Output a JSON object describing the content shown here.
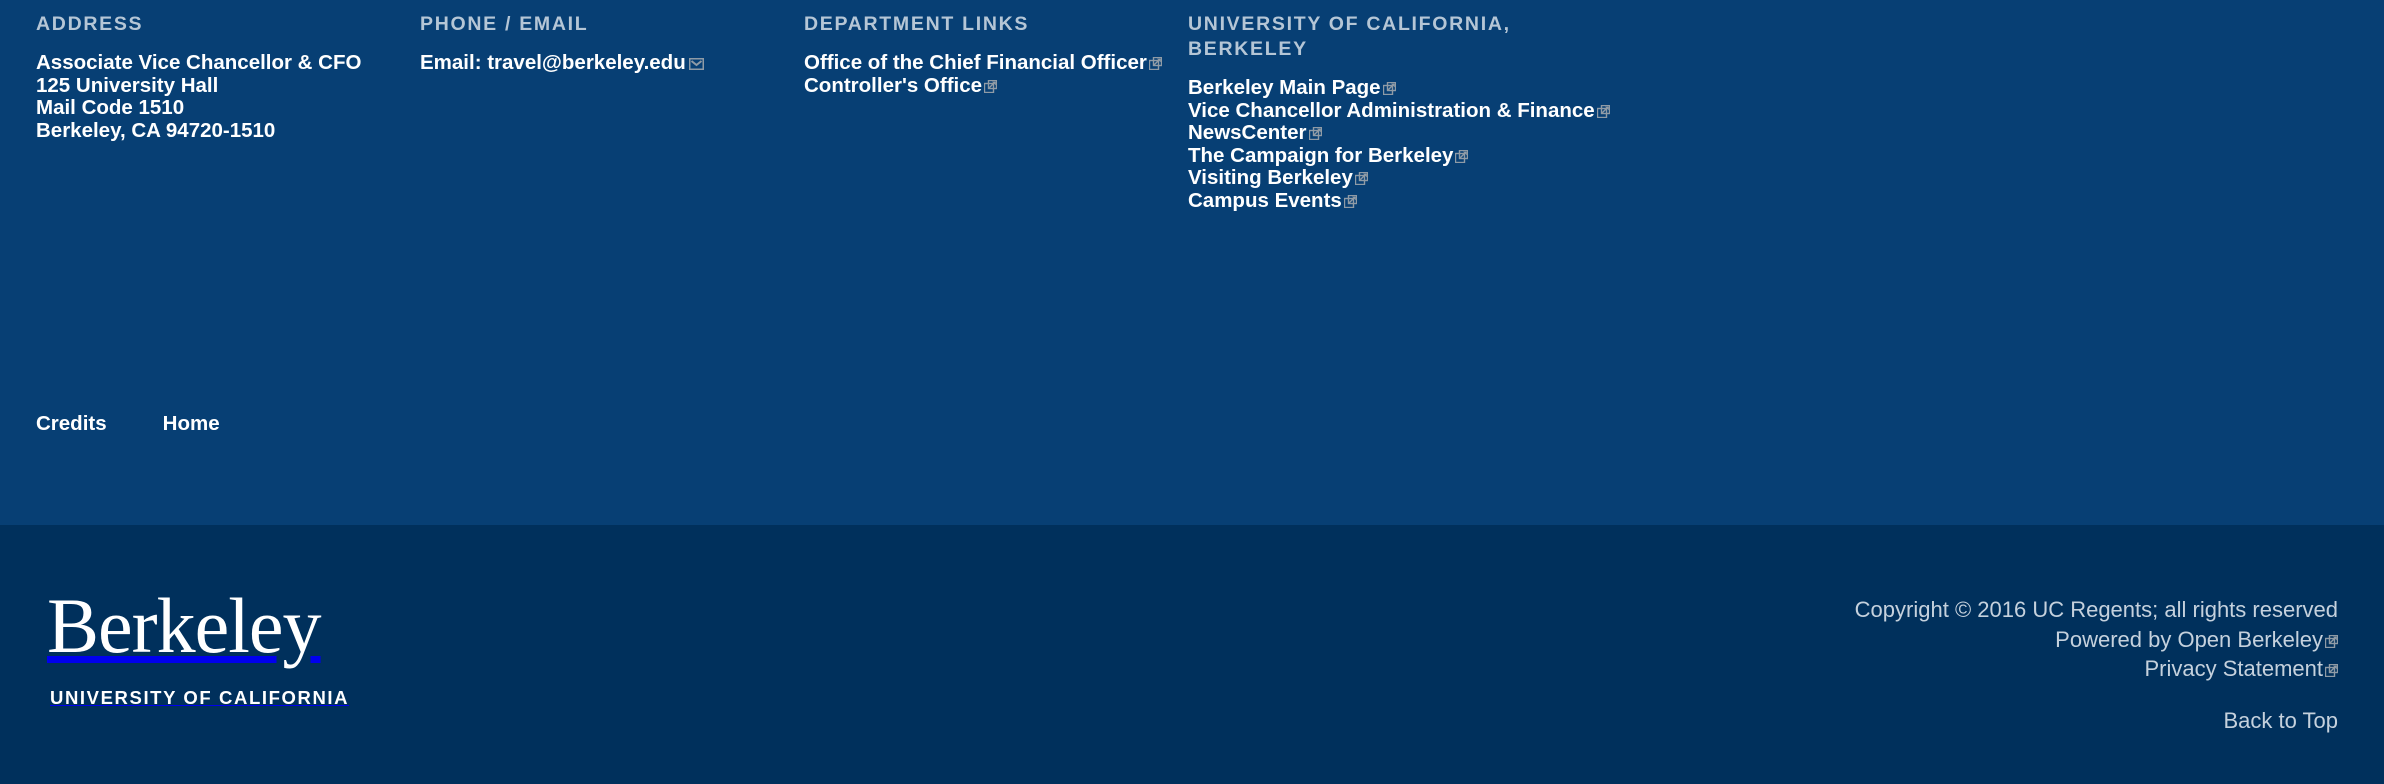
{
  "colors": {
    "upper_band": "#073f74",
    "lower_band": "#00305c",
    "heading": "#b5c6d6",
    "link": "#ffffff",
    "legal": "#c5d1dd",
    "icon": "#8f9ba6"
  },
  "columns": [
    {
      "heading": "ADDRESS",
      "lines": [
        "Associate Vice Chancellor & CFO",
        "125 University Hall",
        "Mail Code 1510",
        "Berkeley, CA 94720-1510"
      ]
    },
    {
      "heading": "PHONE / EMAIL",
      "links": [
        {
          "label": "Email: travel@berkeley.edu",
          "icon": "mail-icon"
        }
      ]
    },
    {
      "heading": "DEPARTMENT LINKS",
      "links": [
        {
          "label": "Office of the Chief Financial Officer",
          "icon": "external-link-icon"
        },
        {
          "label": "Controller's Office",
          "icon": "external-link-icon"
        }
      ]
    },
    {
      "heading": "UNIVERSITY OF CALIFORNIA, BERKELEY",
      "links": [
        {
          "label": "Berkeley Main Page",
          "icon": "external-link-icon"
        },
        {
          "label": "Vice Chancellor Administration & Finance",
          "icon": "external-link-icon"
        },
        {
          "label": "NewsCenter",
          "icon": "external-link-icon"
        },
        {
          "label": "The Campaign for Berkeley",
          "icon": "external-link-icon"
        },
        {
          "label": "Visiting Berkeley",
          "icon": "external-link-icon"
        },
        {
          "label": "Campus Events",
          "icon": "external-link-icon"
        }
      ]
    }
  ],
  "utility": {
    "credits": "Credits",
    "home": "Home"
  },
  "brand": {
    "wordmark": "Berkeley",
    "subtitle": "UNIVERSITY OF CALIFORNIA"
  },
  "legal": {
    "copyright": "Copyright © 2016 UC Regents; all rights reserved",
    "powered_by": "Powered by Open Berkeley",
    "privacy": "Privacy Statement",
    "back_to_top": "Back to Top"
  }
}
